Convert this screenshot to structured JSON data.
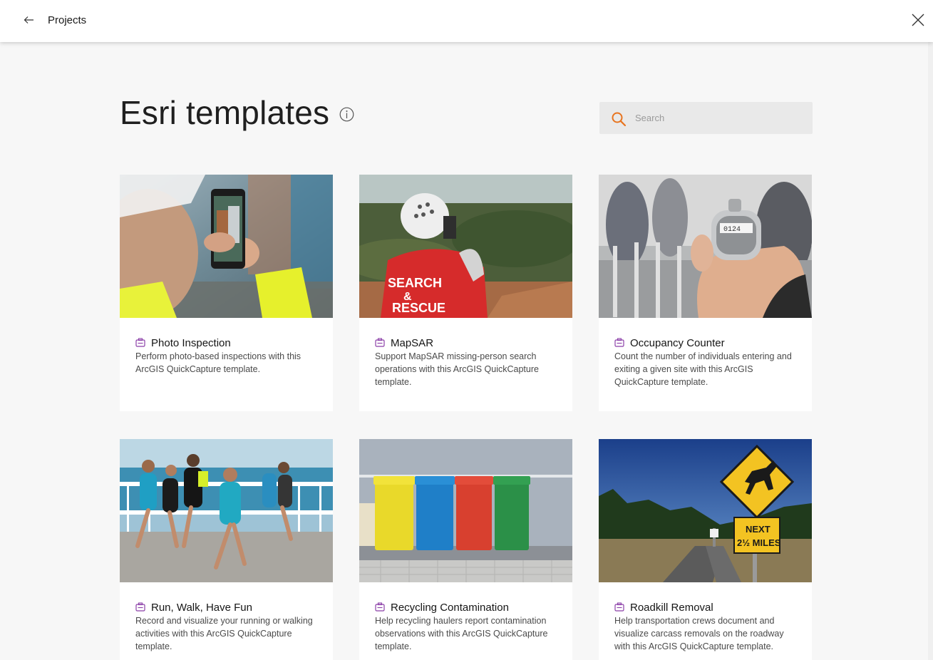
{
  "topbar": {
    "title": "Projects",
    "back_icon": "arrow-left-icon",
    "close_icon": "close-icon"
  },
  "page": {
    "title": "Esri templates",
    "info_icon": "info-icon"
  },
  "search": {
    "placeholder": "Search",
    "value": "",
    "icon": "search-icon"
  },
  "colors": {
    "accent_orange": "#e8741f",
    "template_icon_purple": "#8b3fa8"
  },
  "cards": [
    {
      "title": "Photo Inspection",
      "description": "Perform photo-based inspections with this ArcGIS QuickCapture template.",
      "icon": "quickcapture-template-icon"
    },
    {
      "title": "MapSAR",
      "description": "Support MapSAR missing-person search operations with this ArcGIS QuickCapture template.",
      "icon": "quickcapture-template-icon",
      "image_text": "SEARCH & RESCUE"
    },
    {
      "title": "Occupancy Counter",
      "description": "Count the number of individuals entering and exiting a given site with this ArcGIS QuickCapture template.",
      "icon": "quickcapture-template-icon",
      "image_text": "0124"
    },
    {
      "title": "Run, Walk, Have Fun",
      "description": "Record and visualize your running or walking activities with this ArcGIS QuickCapture template.",
      "icon": "quickcapture-template-icon"
    },
    {
      "title": "Recycling Contamination",
      "description": "Help recycling haulers report contamination observations with this ArcGIS QuickCapture template.",
      "icon": "quickcapture-template-icon"
    },
    {
      "title": "Roadkill Removal",
      "description": "Help transportation crews document and visualize carcass removals on the roadway with this ArcGIS QuickCapture template.",
      "icon": "quickcapture-template-icon",
      "image_text_line1": "NEXT",
      "image_text_line2": "2½ MILES"
    }
  ]
}
